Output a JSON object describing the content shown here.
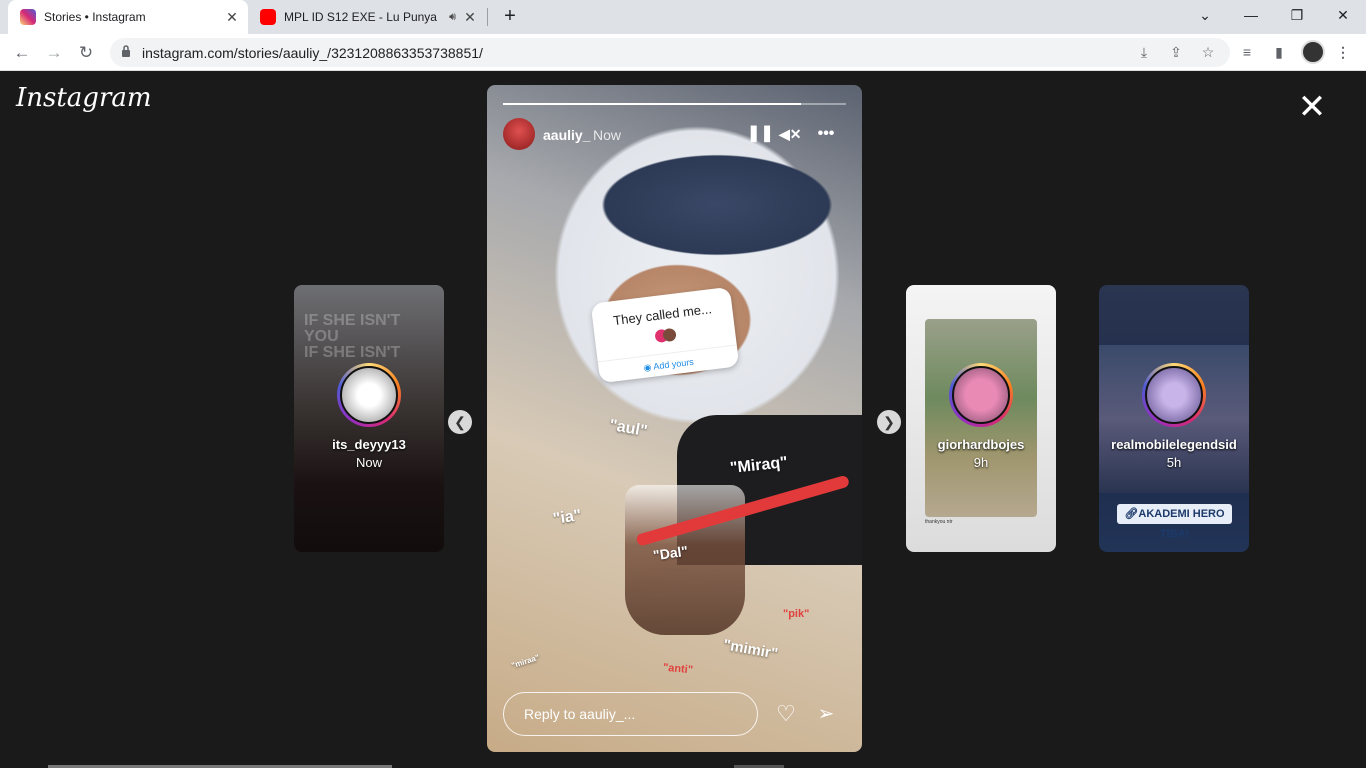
{
  "browser": {
    "tabs": [
      {
        "title": "Stories • Instagram",
        "favicon": "instagram-icon",
        "active": true
      },
      {
        "title": "MPL ID S12 EXE - Lu Punya",
        "favicon": "youtube-icon",
        "active": false,
        "audio": "audio-playing-icon"
      }
    ],
    "url": "instagram.com/stories/aauliy_/3231208863353738851/",
    "new_tab": "+",
    "window": {
      "minimize": "—",
      "restore": "❐",
      "close": "✕",
      "tab_search": "⌄"
    }
  },
  "page": {
    "logo": "Instagram",
    "close": "✕"
  },
  "story": {
    "username": "aauliy_",
    "time": "Now",
    "progress": 0.87,
    "sticker": {
      "question": "They called me...",
      "action": "Add yours"
    },
    "tags": [
      {
        "text": "\"aul\"",
        "color": "#ffffff"
      },
      {
        "text": "\"Miraq\"",
        "color": "#ffffff"
      },
      {
        "text": "\"ia\"",
        "color": "#ffffff"
      },
      {
        "text": "\"Dal\"",
        "color": "#ffffff"
      },
      {
        "text": "\"pik\"",
        "color": "#e0413e"
      },
      {
        "text": "\"mimir\"",
        "color": "#ffffff"
      },
      {
        "text": "\"anti\"",
        "color": "#e0413e"
      },
      {
        "text": "\"miraa\"",
        "color": "#ffffff"
      }
    ],
    "reply_placeholder": "Reply to aauliy_..."
  },
  "previews": [
    {
      "username": "its_deyyy13",
      "time": "Now",
      "overlay": "IF SHE ISN'T\nYOU\nIF SHE ISN'T"
    },
    {
      "username": "giorhardbojes",
      "time": "9h",
      "caption": "thankyou ntr"
    },
    {
      "username": "realmobilelegendsid",
      "time": "5h",
      "link": "AKADEMI HERO TIBA!"
    }
  ],
  "colors": {
    "accent": "#ffffff",
    "link": "#1f8ce6",
    "bg": "#1a1a1a"
  }
}
